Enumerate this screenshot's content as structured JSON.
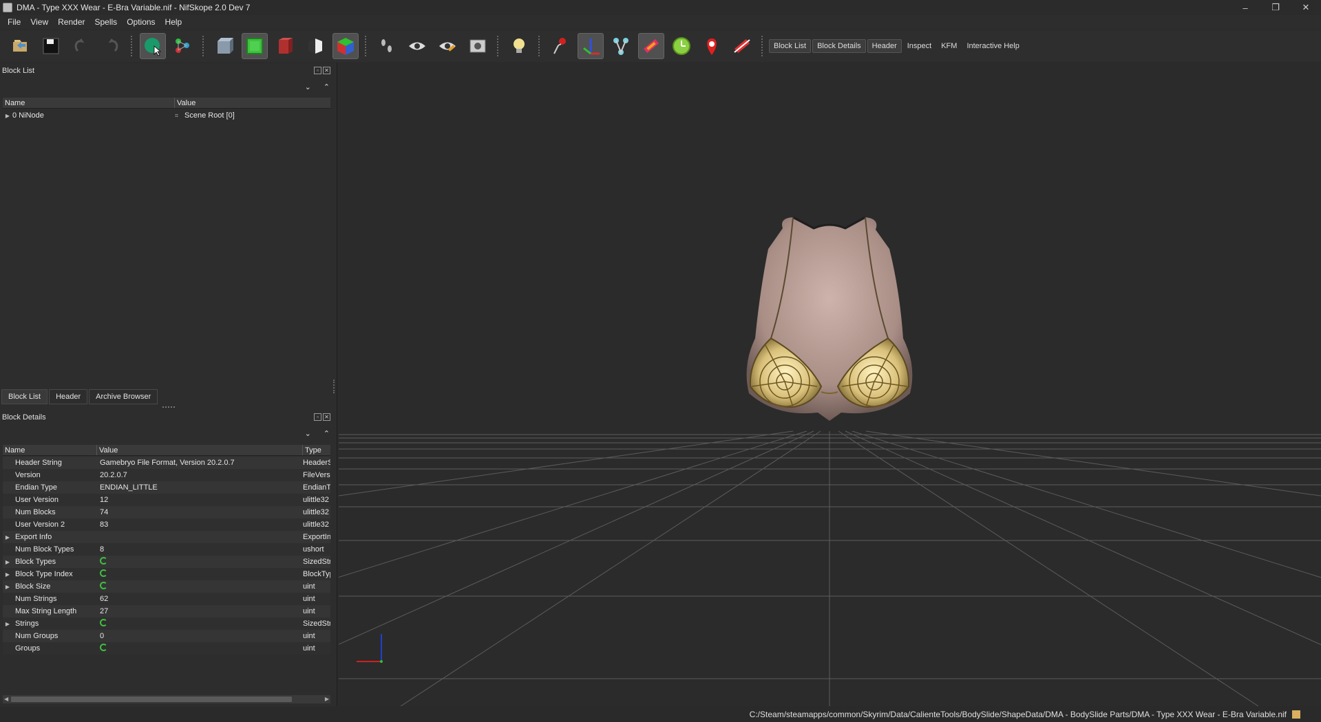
{
  "window": {
    "title": "DMA - Type XXX Wear - E-Bra Variable.nif - NifSkope 2.0 Dev 7",
    "minimize": "–",
    "restore": "❐",
    "close": "✕"
  },
  "menu": [
    "File",
    "View",
    "Render",
    "Spells",
    "Options",
    "Help"
  ],
  "toolbar": {
    "text_buttons": [
      "Block List",
      "Block Details",
      "Header",
      "Inspect",
      "KFM",
      "Interactive Help"
    ]
  },
  "block_list": {
    "title": "Block List",
    "columns": [
      "Name",
      "Value"
    ],
    "rows": [
      {
        "name": "0 NiNode",
        "value": "Scene Root [0]"
      }
    ]
  },
  "tabs": [
    "Block List",
    "Header",
    "Archive Browser"
  ],
  "block_details": {
    "title": "Block Details",
    "columns": [
      "Name",
      "Value",
      "Type"
    ],
    "rows": [
      {
        "name": "Header String",
        "value": "Gamebryo File Format, Version 20.2.0.7",
        "type": "HeaderS",
        "expand": false,
        "icon": false
      },
      {
        "name": "Version",
        "value": "20.2.0.7",
        "type": "FileVersi",
        "expand": false,
        "icon": false
      },
      {
        "name": "Endian Type",
        "value": "ENDIAN_LITTLE",
        "type": "EndianT",
        "expand": false,
        "icon": false
      },
      {
        "name": "User Version",
        "value": "12",
        "type": "ulittle32",
        "expand": false,
        "icon": false
      },
      {
        "name": "Num Blocks",
        "value": "74",
        "type": "ulittle32",
        "expand": false,
        "icon": false
      },
      {
        "name": "User Version 2",
        "value": "83",
        "type": "ulittle32",
        "expand": false,
        "icon": false
      },
      {
        "name": "Export Info",
        "value": "",
        "type": "ExportIn",
        "expand": true,
        "icon": false
      },
      {
        "name": "Num Block Types",
        "value": "8",
        "type": "ushort",
        "expand": false,
        "icon": false
      },
      {
        "name": "Block Types",
        "value": "",
        "type": "SizedStri",
        "expand": true,
        "icon": true
      },
      {
        "name": "Block Type Index",
        "value": "",
        "type": "BlockTyp",
        "expand": true,
        "icon": true
      },
      {
        "name": "Block Size",
        "value": "",
        "type": "uint",
        "expand": true,
        "icon": true
      },
      {
        "name": "Num Strings",
        "value": "62",
        "type": "uint",
        "expand": false,
        "icon": false
      },
      {
        "name": "Max String Length",
        "value": "27",
        "type": "uint",
        "expand": false,
        "icon": false
      },
      {
        "name": "Strings",
        "value": "",
        "type": "SizedStri",
        "expand": true,
        "icon": true
      },
      {
        "name": "Num Groups",
        "value": "0",
        "type": "uint",
        "expand": false,
        "icon": false
      },
      {
        "name": "Groups",
        "value": "",
        "type": "uint",
        "expand": false,
        "icon": true
      }
    ]
  },
  "status": {
    "path": "C:/Steam/steamapps/common/Skyrim/Data/CalienteTools/BodySlide/ShapeData/DMA - BodySlide Parts/DMA - Type XXX Wear - E-Bra Variable.nif"
  },
  "colors": {
    "background": "#2b2b2b",
    "panel": "#2d2d2d",
    "grid": "#5a5a5a",
    "axis_x": "#d02020",
    "axis_y": "#2040d0"
  }
}
